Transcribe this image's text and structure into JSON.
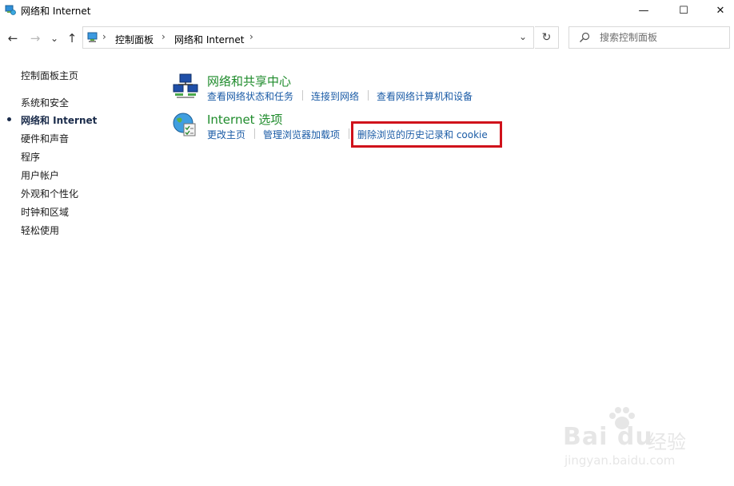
{
  "window": {
    "title": "网络和 Internet",
    "controls": {
      "minimize": "—",
      "maximize": "☐",
      "close": "✕"
    }
  },
  "nav": {
    "back": "←",
    "forward": "→",
    "recent": "⌄",
    "up": "↑",
    "breadcrumb": [
      "控制面板",
      "网络和 Internet"
    ],
    "sep": "›",
    "dropdown": "⌄",
    "refresh": "↻"
  },
  "search": {
    "placeholder": "搜索控制面板"
  },
  "sidebar": {
    "items": [
      {
        "label": "控制面板主页",
        "active": false
      },
      {
        "label": "系统和安全",
        "active": false
      },
      {
        "label": "网络和 Internet",
        "active": true
      },
      {
        "label": "硬件和声音",
        "active": false
      },
      {
        "label": "程序",
        "active": false
      },
      {
        "label": "用户帐户",
        "active": false
      },
      {
        "label": "外观和个性化",
        "active": false
      },
      {
        "label": "时钟和区域",
        "active": false
      },
      {
        "label": "轻松使用",
        "active": false
      }
    ]
  },
  "categories": [
    {
      "title": "网络和共享中心",
      "icon": "network-sharing-icon",
      "links": [
        "查看网络状态和任务",
        "连接到网络",
        "查看网络计算机和设备"
      ]
    },
    {
      "title": "Internet 选项",
      "icon": "internet-options-icon",
      "links": [
        "更改主页",
        "管理浏览器加载项",
        "删除浏览的历史记录和 cookie"
      ]
    }
  ],
  "watermark": {
    "logo": "Bai du",
    "brand": "经验",
    "url": "jingyan.baidu.com"
  },
  "colors": {
    "link": "#1a5ba6",
    "category_title": "#1e8b2b",
    "highlight": "#d0121b"
  }
}
